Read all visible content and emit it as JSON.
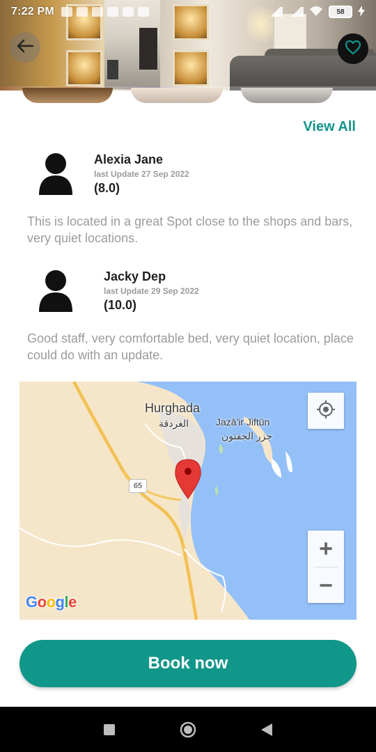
{
  "status_bar": {
    "time": "7:22 PM",
    "battery": "58"
  },
  "header": {
    "back_icon": "arrow-left-icon",
    "favorite_icon": "heart-outline-icon"
  },
  "reviews": {
    "view_all_label": "View All",
    "items": [
      {
        "name": "Alexia Jane",
        "date": "last Update 27 Sep 2022",
        "score": "(8.0)",
        "text": "This is located in a great Spot close to the shops and bars, very quiet locations."
      },
      {
        "name": "Jacky Dep",
        "date": "last Update 29 Sep 2022",
        "score": "(10.0)",
        "text": "Good staff, very comfortable bed, very quiet location, place could do with an update."
      }
    ]
  },
  "map": {
    "city_label": "Hurghada",
    "city_label_ar": "الغردقة",
    "island_label": "Jazā'ir Jiftūn",
    "island_label_ar": "جزر الجفتون",
    "road_shield": "65",
    "zoom_in": "+",
    "zoom_out": "−",
    "attribution": "Google",
    "colors": {
      "water": "#94c0f8",
      "land": "#f6e6c9",
      "road": "#f5c760",
      "pin": "#e53935"
    }
  },
  "actions": {
    "book_label": "Book now"
  },
  "theme": {
    "accent": "#11968a"
  }
}
